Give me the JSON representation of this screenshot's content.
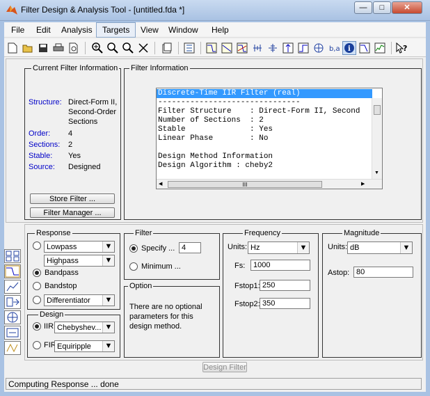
{
  "window": {
    "title": "Filter Design & Analysis Tool -  [untitled.fda *]"
  },
  "menu": [
    "File",
    "Edit",
    "Analysis",
    "Targets",
    "View",
    "Window",
    "Help"
  ],
  "toolbar": [
    "new-icon",
    "open-icon",
    "save-icon",
    "print-icon",
    "print-preview-icon",
    "zoom-in-icon",
    "zoom-x-icon",
    "zoom-y-icon",
    "full-view-icon",
    "new-figure-icon",
    "design-mode-icon",
    "magnitude-response-icon",
    "phase-response-icon",
    "magnitude-phase-icon",
    "group-delay-icon",
    "phase-delay-icon",
    "impulse-response-icon",
    "step-response-icon",
    "pole-zero-icon",
    "coefficients-icon",
    "filter-info-icon",
    "magnitude-estimate-icon",
    "round-off-noise-icon",
    "whats-this-icon"
  ],
  "current_filter": {
    "title": "Current Filter Information",
    "structure_label": "Structure:",
    "structure_value": "Direct-Form II, Second-Order Sections",
    "structure_lines": [
      "Direct-Form II,",
      "Second-Order",
      "Sections"
    ],
    "order_label": "Order:",
    "order_value": "4",
    "sections_label": "Sections:",
    "sections_value": "2",
    "stable_label": "Stable:",
    "stable_value": "Yes",
    "source_label": "Source:",
    "source_value": "Designed",
    "store_button": "Store Filter ...",
    "manager_button": "Filter Manager ..."
  },
  "filter_info": {
    "title": "Filter Information",
    "lines": [
      "Discrete-Time IIR Filter (real)",
      "-------------------------------",
      "Filter Structure    : Direct-Form II, Second",
      "Number of Sections  : 2",
      "Stable              : Yes",
      "Linear Phase        : No",
      "",
      "Design Method Information",
      "Design Algorithm : cheby2"
    ],
    "scroll_grip": "III"
  },
  "response": {
    "title": "Response",
    "lowpass": "Lowpass",
    "highpass": "Highpass",
    "bandpass": "Bandpass",
    "bandstop": "Bandstop",
    "differentiator": "Differentiator"
  },
  "design": {
    "title": "Design",
    "iir_label": "IIR",
    "iir_value": "Chebyshev...",
    "fir_label": "FIR",
    "fir_value": "Equiripple"
  },
  "filter_order": {
    "title": "Filter",
    "specify_label": "Specify ...",
    "specify_value": "4",
    "minimum_label": "Minimum ..."
  },
  "options": {
    "title": "Option",
    "text_lines": [
      "There are no optional",
      "parameters for this",
      "design method."
    ]
  },
  "frequency": {
    "title": "Frequency",
    "units_label": "Units:",
    "units_value": "Hz",
    "fs_label": "Fs:",
    "fs_value": "1000",
    "fstop1_label": "Fstop1:",
    "fstop1_value": "250",
    "fstop2_label": "Fstop2:",
    "fstop2_value": "350"
  },
  "magnitude": {
    "title": "Magnitude",
    "units_label": "Units:",
    "units_value": "dB",
    "astop_label": "Astop:",
    "astop_value": "80"
  },
  "design_button": "Design Filter",
  "status": "Computing Response ... done",
  "colors": {
    "accent": "#0000c8",
    "selection": "#3399ff"
  }
}
